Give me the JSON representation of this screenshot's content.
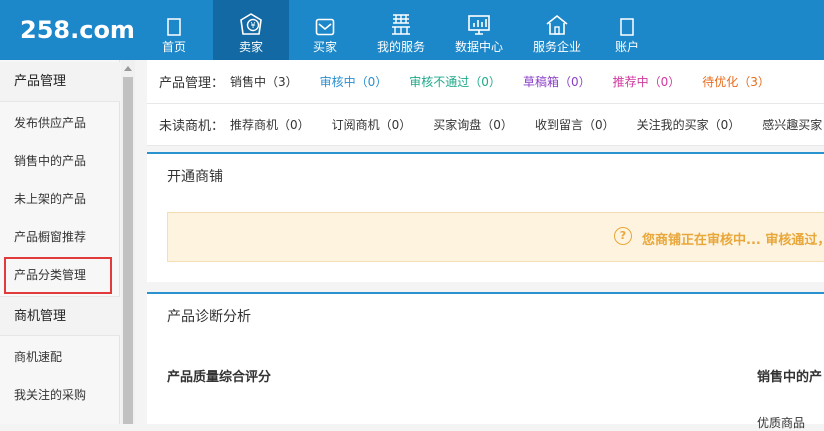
{
  "logo": "258.com",
  "nav": [
    {
      "label": "首页",
      "icon": "page-icon"
    },
    {
      "label": "卖家",
      "icon": "seller-bag-icon"
    },
    {
      "label": "买家",
      "icon": "mail-icon"
    },
    {
      "label": "我的服务",
      "icon": "service-icon"
    },
    {
      "label": "数据中心",
      "icon": "monitor-chart-icon"
    },
    {
      "label": "服务企业",
      "icon": "house-icon"
    },
    {
      "label": "账户",
      "icon": "page-icon"
    }
  ],
  "sidebar": {
    "items": [
      {
        "label": "产品管理",
        "type": "head"
      },
      {
        "label": "发布供应产品"
      },
      {
        "label": "销售中的产品"
      },
      {
        "label": "未上架的产品"
      },
      {
        "label": "产品橱窗推荐"
      },
      {
        "label": "产品分类管理"
      },
      {
        "label": "商机管理",
        "type": "head"
      },
      {
        "label": "商机速配"
      },
      {
        "label": "我关注的采购"
      }
    ]
  },
  "product_status": {
    "label": "产品管理：",
    "items": [
      {
        "text": "销售中（3）",
        "color": "#333333"
      },
      {
        "text": "审核中（0）",
        "color": "#2a8fd1"
      },
      {
        "text": "审核不通过（0）",
        "color": "#1fa98a"
      },
      {
        "text": "草稿箱（0）",
        "color": "#8a3fc7"
      },
      {
        "text": "推荐中（0）",
        "color": "#d0389f"
      },
      {
        "text": "待优化（3）",
        "color": "#e86a1a"
      }
    ]
  },
  "leads_status": {
    "label": "未读商机：",
    "items": [
      {
        "text": "推荐商机（0）"
      },
      {
        "text": "订阅商机（0）"
      },
      {
        "text": "买家询盘（0）"
      },
      {
        "text": "收到留言（0）"
      },
      {
        "text": "关注我的买家（0）"
      },
      {
        "text": "感兴趣买家"
      }
    ]
  },
  "shop_panel": {
    "title": "开通商铺",
    "notice": "您商铺正在审核中... 审核通过，手"
  },
  "diagnosis_panel": {
    "title": "产品诊断分析",
    "quality_title": "产品质量综合评分",
    "selling_title": "销售中的产",
    "quality_label": "优质商品"
  }
}
